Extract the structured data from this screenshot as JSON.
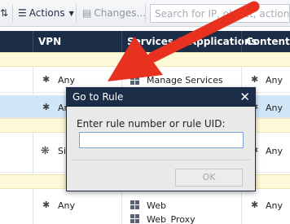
{
  "toolbar": {
    "actions_label": "Actions",
    "changes_label": "Changes...",
    "search_placeholder": "Search for IP, object, action, ..."
  },
  "table": {
    "columns": [
      "VPN",
      "Services & Applications",
      "Content"
    ],
    "rows": [
      {
        "vpn": "Any",
        "services": "Manage Services",
        "content": "Any"
      },
      {
        "vpn": "Any",
        "services": "",
        "content": "Any"
      },
      {
        "vpn": "Site",
        "services": "",
        "content": "Any"
      },
      {
        "vpn": "Any",
        "services": "Web",
        "content": "Any"
      },
      {
        "vpn": "",
        "services": "Web_Proxy",
        "content": ""
      }
    ]
  },
  "dialog": {
    "title": "Go to Rule",
    "prompt": "Enter rule number or rule UID:",
    "input_value": "",
    "ok_label": "OK",
    "close_symbol": "✕"
  },
  "colors": {
    "header_bg": "#1b2d47",
    "selected_row": "#cfe6f7",
    "section_band": "#fdf8d8",
    "arrow": "#e8311e"
  }
}
